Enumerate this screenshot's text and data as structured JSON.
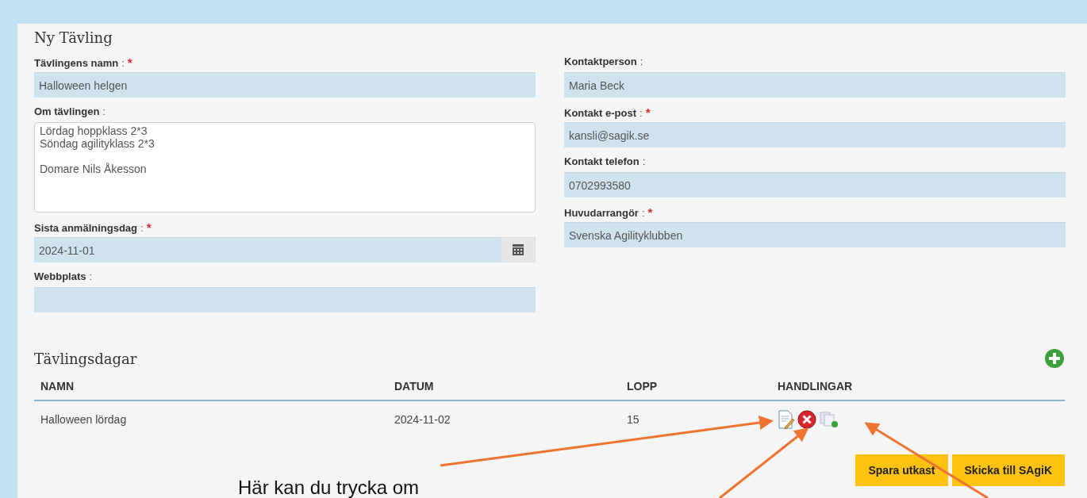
{
  "title": "Ny Tävling",
  "left_fields": [
    {
      "kind": "text",
      "label": "Tävlingens namn",
      "colon": ":",
      "required_mark": "*",
      "value": "Halloween helgen"
    },
    {
      "kind": "textarea",
      "label": "Om tävlingen",
      "colon": ":",
      "value": "Lördag hoppklass 2*3\nSöndag agilityklass 2*3\n\nDomare Nils Åkesson"
    },
    {
      "kind": "date",
      "label": "Sista anmälningsdag",
      "colon": ":",
      "required_mark": "*",
      "value": "2024-11-01"
    },
    {
      "kind": "text",
      "label": "Webbplats",
      "colon": ":"
    }
  ],
  "right_fields": [
    {
      "kind": "text",
      "label": "Kontaktperson",
      "colon": ":",
      "value": "Maria Beck"
    },
    {
      "kind": "text",
      "label": "Kontakt e-post",
      "colon": ":",
      "required_mark": "*",
      "value": "kansli@sagik.se"
    },
    {
      "kind": "text",
      "label": "Kontakt telefon",
      "colon": ":",
      "value": "0702993580"
    },
    {
      "kind": "text",
      "label": "Huvudarrangör",
      "colon": ":",
      "required_mark": "*",
      "value": "Svenska Agilityklubben"
    }
  ],
  "days": {
    "title": "Tävlingsdagar",
    "columns": [
      "NAMN",
      "DATUM",
      "LOPP",
      "HANDLINGAR"
    ],
    "rows": [
      {
        "cells": [
          "Halloween lördag",
          "2024-11-02",
          "15"
        ]
      }
    ]
  },
  "buttons": [
    "Spara utkast",
    "Skicka till SAgiK"
  ],
  "annotation": "Här kan du trycka om"
}
